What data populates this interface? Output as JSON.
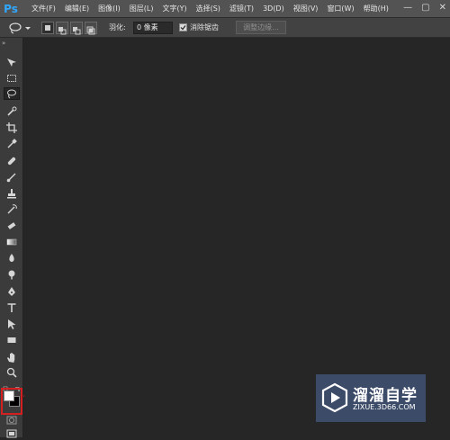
{
  "app": {
    "logo": "Ps"
  },
  "menu": [
    "文件(F)",
    "编辑(E)",
    "图像(I)",
    "图层(L)",
    "文字(Y)",
    "选择(S)",
    "滤镜(T)",
    "3D(D)",
    "视图(V)",
    "窗口(W)",
    "帮助(H)"
  ],
  "window_controls": {
    "minimize": "—",
    "restore": "▢",
    "close": "✕"
  },
  "options_bar": {
    "feather_label": "羽化:",
    "feather_value": "0 像素",
    "antialias_label": "消除锯齿",
    "refine_edge_label": "调整边缘..."
  },
  "tools": [
    "move",
    "marquee",
    "lasso",
    "quick-select",
    "crop",
    "eyedropper",
    "healing-brush",
    "brush",
    "clone-stamp",
    "history-brush",
    "eraser",
    "gradient",
    "blur",
    "dodge",
    "pen",
    "type",
    "path-select",
    "rectangle",
    "hand",
    "zoom"
  ],
  "swatch_colors": {
    "foreground": "#ffffff",
    "background": "#000000"
  },
  "watermark": {
    "title": "溜溜自学",
    "url": "ZIXUE.3D66.COM"
  }
}
